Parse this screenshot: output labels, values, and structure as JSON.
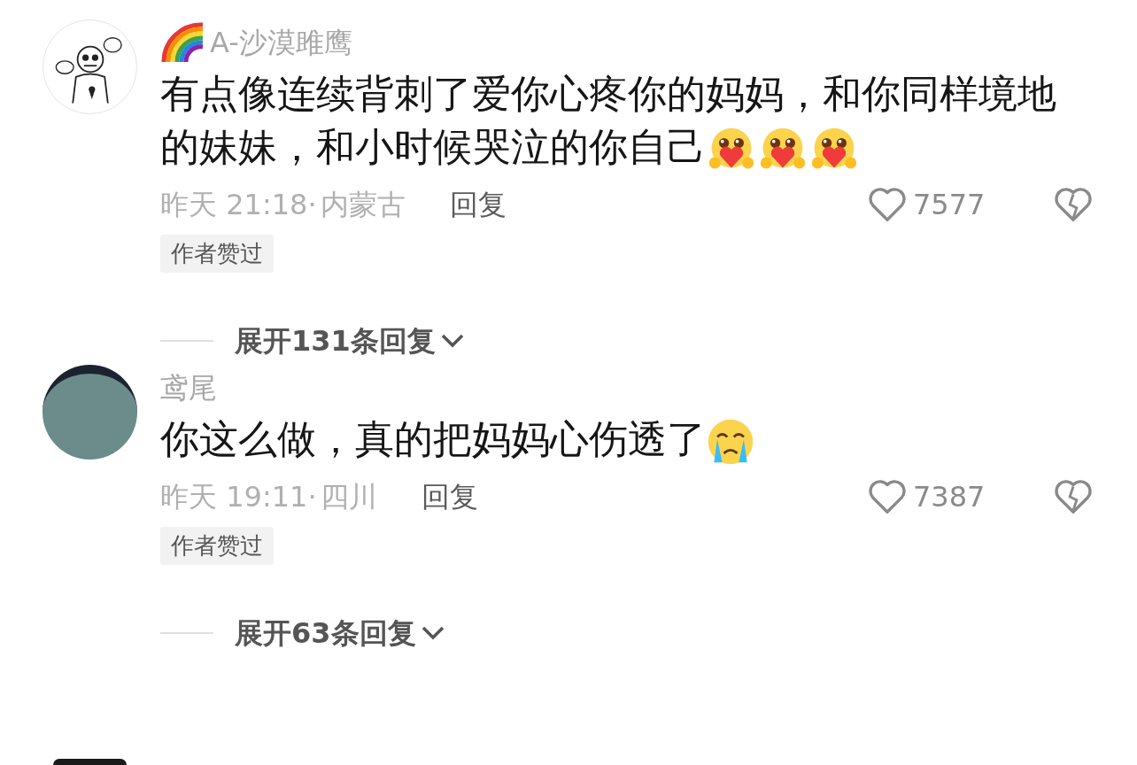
{
  "comments": [
    {
      "username": "A-沙漠雎鹰",
      "rainbow_badge": true,
      "avatar": {
        "kind": "drawing"
      },
      "text": "有点像连续背刺了爱你心疼你的妈妈，和你同样境地的妹妹，和小时候哭泣的你自己",
      "emojis": [
        {
          "kind": "hug_heart"
        },
        {
          "kind": "hug_heart"
        },
        {
          "kind": "hug_heart"
        }
      ],
      "time": "昨天 21:18·",
      "location": "内蒙古",
      "reply": "回复",
      "likes": "7577",
      "liked": false,
      "disliked": false,
      "author_liked": "作者赞过",
      "expand": "展开131条回复"
    },
    {
      "username": "鸢尾",
      "rainbow_badge": false,
      "avatar": {
        "kind": "photo"
      },
      "text": "你这么做，真的把妈妈心伤透了",
      "emojis": [
        {
          "kind": "crying"
        }
      ],
      "time": "昨天 19:11·",
      "location": "四川",
      "reply": "回复",
      "likes": "7387",
      "liked": false,
      "disliked": false,
      "author_liked": "作者赞过",
      "expand": "展开63条回复"
    }
  ]
}
